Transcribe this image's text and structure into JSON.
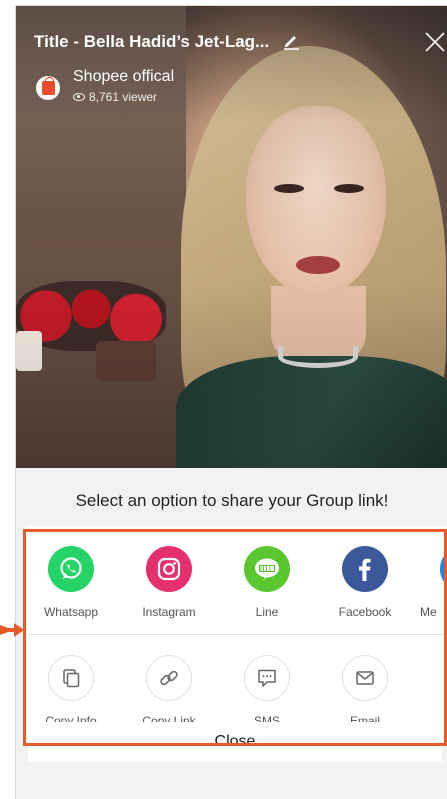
{
  "video": {
    "title": "Title - Bella Hadid’s Jet-Lag...",
    "channel": "Shopee offical",
    "viewers": "8,761 viewer"
  },
  "sheet": {
    "prompt": "Select an option to share your Group link!",
    "share_options": [
      {
        "label": "Whatsapp",
        "icon": "whatsapp-icon",
        "color": "#25D366"
      },
      {
        "label": "Instagram",
        "icon": "instagram-icon",
        "color": "#E4306C"
      },
      {
        "label": "Line",
        "icon": "line-icon",
        "color": "#5AC630"
      },
      {
        "label": "Facebook",
        "icon": "facebook-icon",
        "color": "#3B5998"
      },
      {
        "label": "Me",
        "icon": "messenger-icon",
        "color": "#1E88E5"
      }
    ],
    "actions": [
      {
        "label": "Copy Info",
        "icon": "copy-icon"
      },
      {
        "label": "Copy Link",
        "icon": "link-icon"
      },
      {
        "label": "SMS",
        "icon": "sms-icon"
      },
      {
        "label": "Email",
        "icon": "email-icon"
      }
    ],
    "close_label": "Close"
  },
  "colors": {
    "brand": "#EE4D2D",
    "highlight": "#E95A2A"
  }
}
